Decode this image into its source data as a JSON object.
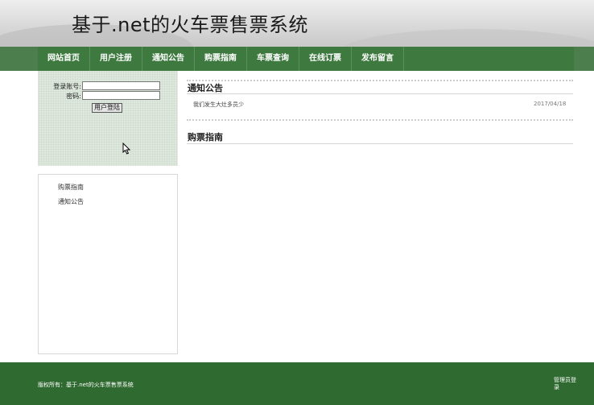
{
  "header": {
    "title": "基于.net的火车票售票系统"
  },
  "nav": {
    "items": [
      {
        "label": "网站首页"
      },
      {
        "label": "用户注册"
      },
      {
        "label": "通知公告"
      },
      {
        "label": "购票指南"
      },
      {
        "label": "车票查询"
      },
      {
        "label": "在线订票"
      },
      {
        "label": "发布留言"
      }
    ]
  },
  "login": {
    "account_label": "登录账号:",
    "password_label": "密码:",
    "account_value": "",
    "password_value": "",
    "button_label": "用户登陆"
  },
  "sidebar": {
    "items": [
      {
        "label": "购票指南"
      },
      {
        "label": "通知公告"
      }
    ]
  },
  "notices": {
    "title": "通知公告",
    "items": [
      {
        "title": "我们发生大灶多员少",
        "date": "2017/04/18"
      }
    ]
  },
  "guide": {
    "title": "购票指南"
  },
  "footer": {
    "copyright": "版权所有：基于.net的火车票售票系统",
    "admin_login": "管理员登录"
  },
  "colors": {
    "nav_bg": "#3e7a3f",
    "footer_bg": "#2f6a31",
    "login_bg": "#dfe8df"
  },
  "icons": {
    "cursor": "mouse-pointer-icon"
  }
}
